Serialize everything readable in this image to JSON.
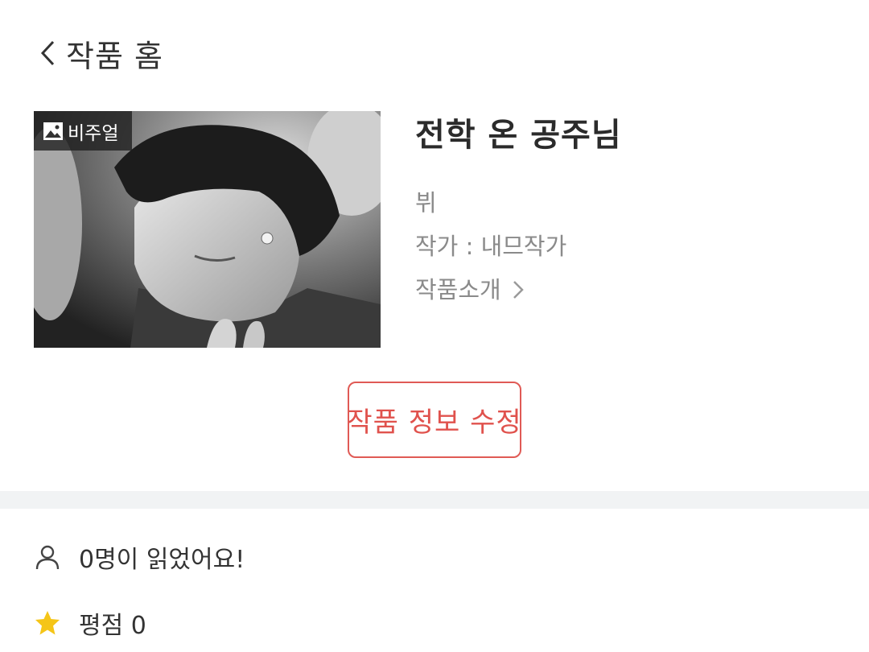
{
  "header": {
    "back_icon": "chevron-left-icon",
    "title": "작품 홈"
  },
  "work": {
    "cover_badge": "비주얼",
    "cover_badge_icon": "image-icon",
    "title": "전학 온 공주님",
    "genre": "뷔",
    "author": "작가 : 내므작가",
    "intro_label": "작품소개",
    "intro_icon": "chevron-right-icon"
  },
  "actions": {
    "edit_label": "작품 정보 수정",
    "edit_color": "#e0524d"
  },
  "stats": {
    "readers_icon": "person-icon",
    "readers_text": "0명이 읽었어요!",
    "rating_icon": "star-icon",
    "rating_text": "평점 0",
    "star_color": "#f5c518"
  }
}
